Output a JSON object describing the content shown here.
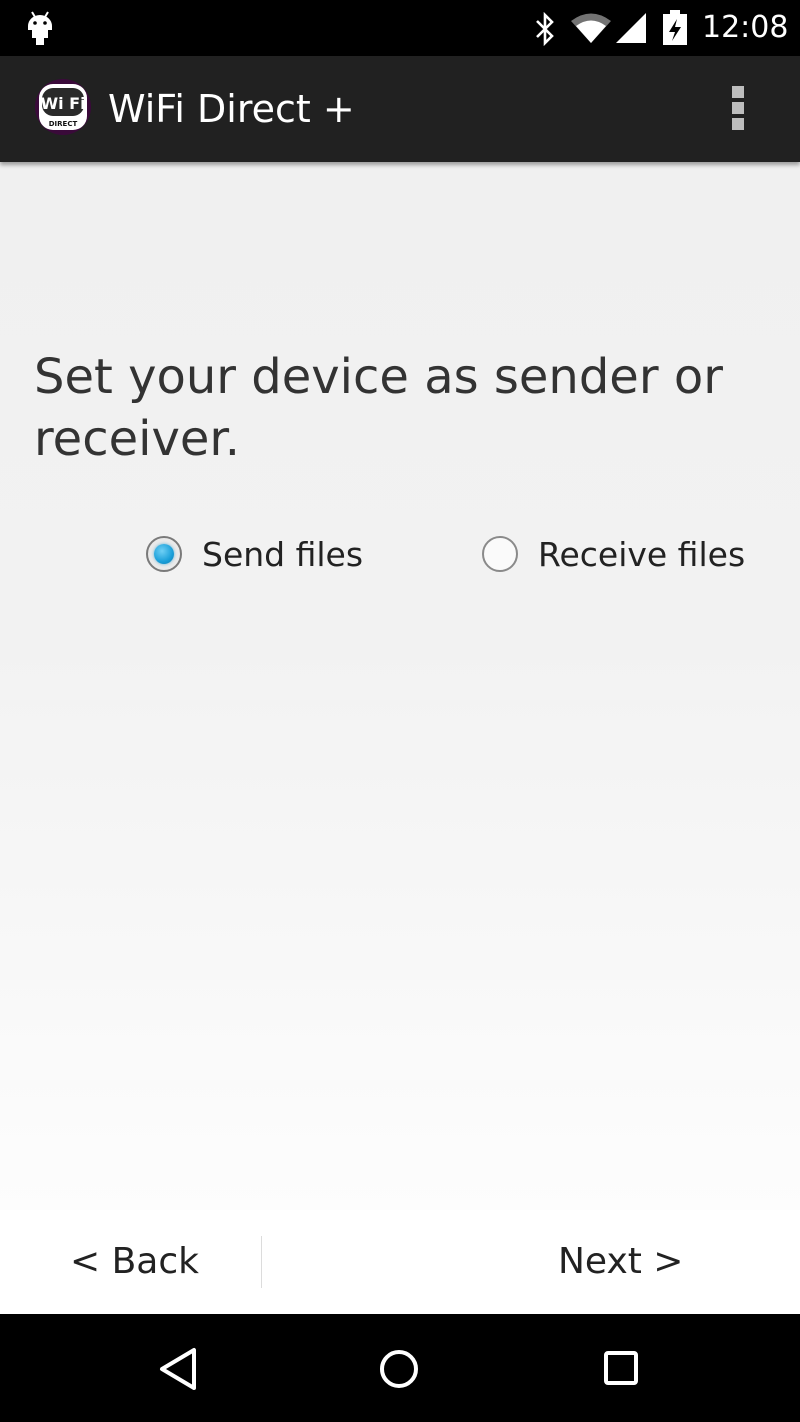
{
  "status_bar": {
    "time": "12:08",
    "icons": [
      "android-notification-icon",
      "bluetooth-icon",
      "wifi-icon",
      "cell-signal-icon",
      "battery-charging-icon"
    ]
  },
  "action_bar": {
    "logo_icon": "wifi-direct-logo",
    "logo_text_top": "Wi Fi",
    "logo_text_bottom": "DIRECT",
    "title": "WiFi Direct +",
    "overflow_icon": "overflow-menu-icon"
  },
  "main": {
    "prompt": "Set your device as sender or receiver.",
    "options": [
      {
        "label": "Send files",
        "selected": true
      },
      {
        "label": "Receive files",
        "selected": false
      }
    ]
  },
  "bottom_buttons": {
    "back_label": "< Back",
    "next_label": "Next >"
  },
  "system_nav": {
    "icons": [
      "back-triangle-icon",
      "home-circle-icon",
      "recents-square-icon"
    ]
  },
  "colors": {
    "action_bar": "#212121",
    "radio_accent": "#1a9fd9",
    "content_bg": "#f2f2f2"
  }
}
